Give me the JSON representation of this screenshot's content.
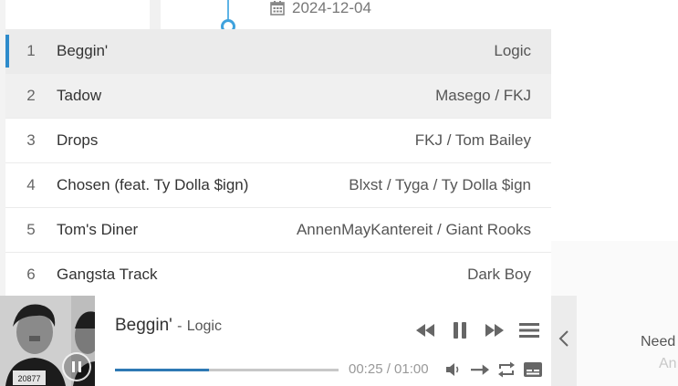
{
  "background": {
    "date": "2024-12-04",
    "need_text": "Need",
    "an_text": "An"
  },
  "playlist": [
    {
      "index": "1",
      "title": "Beggin'",
      "artist": "Logic"
    },
    {
      "index": "2",
      "title": "Tadow",
      "artist": "Masego / FKJ"
    },
    {
      "index": "3",
      "title": "Drops",
      "artist": "FKJ / Tom Bailey"
    },
    {
      "index": "4",
      "title": "Chosen (feat. Ty Dolla $ign)",
      "artist": "Blxst / Tyga / Ty Dolla $ign"
    },
    {
      "index": "5",
      "title": "Tom's Diner",
      "artist": "AnnenMayKantereit / Giant Rooks"
    },
    {
      "index": "6",
      "title": "Gangsta Track",
      "artist": "Dark Boy"
    }
  ],
  "player": {
    "title": "Beggin'",
    "separator": "-",
    "artist": "Logic",
    "time": "00:25 / 01:00",
    "progress_fraction": 0.42,
    "cover_text": "20877",
    "accent_color": "#2e79b4"
  },
  "icons": {
    "calendar": "calendar-icon",
    "prev": "skip-back-icon",
    "pause": "pause-icon",
    "next": "skip-forward-icon",
    "menu": "playlist-menu-icon",
    "volume": "volume-icon",
    "order": "order-icon",
    "loop": "loop-icon",
    "lyrics": "lyrics-icon",
    "collapse": "chevron-left-icon"
  }
}
